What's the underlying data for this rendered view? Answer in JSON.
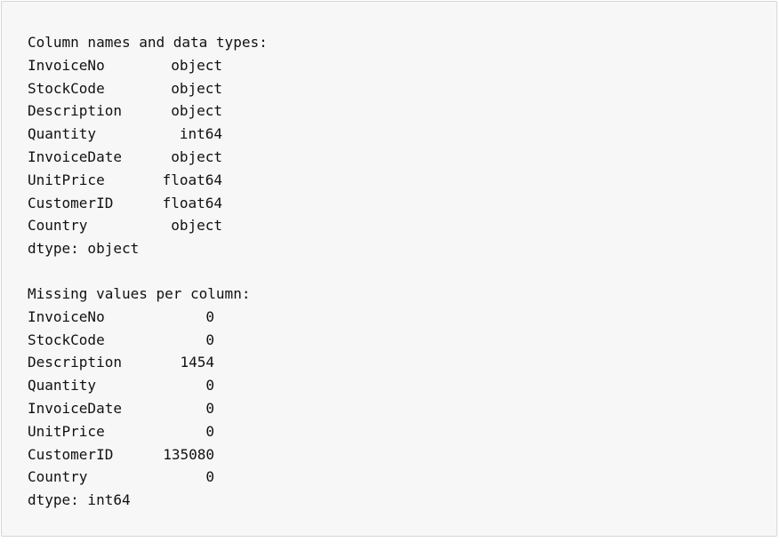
{
  "dtypes_section": {
    "header": "Column names and data types:",
    "rows": [
      {
        "name": "InvoiceNo",
        "value": "object"
      },
      {
        "name": "StockCode",
        "value": "object"
      },
      {
        "name": "Description",
        "value": "object"
      },
      {
        "name": "Quantity",
        "value": "int64"
      },
      {
        "name": "InvoiceDate",
        "value": "object"
      },
      {
        "name": "UnitPrice",
        "value": "float64"
      },
      {
        "name": "CustomerID",
        "value": "float64"
      },
      {
        "name": "Country",
        "value": "object"
      }
    ],
    "footer": "dtype: object"
  },
  "missing_section": {
    "header": "Missing values per column:",
    "rows": [
      {
        "name": "InvoiceNo",
        "value": "0"
      },
      {
        "name": "StockCode",
        "value": "0"
      },
      {
        "name": "Description",
        "value": "1454"
      },
      {
        "name": "Quantity",
        "value": "0"
      },
      {
        "name": "InvoiceDate",
        "value": "0"
      },
      {
        "name": "UnitPrice",
        "value": "0"
      },
      {
        "name": "CustomerID",
        "value": "135080"
      },
      {
        "name": "Country",
        "value": "0"
      }
    ],
    "footer": "dtype: int64"
  }
}
